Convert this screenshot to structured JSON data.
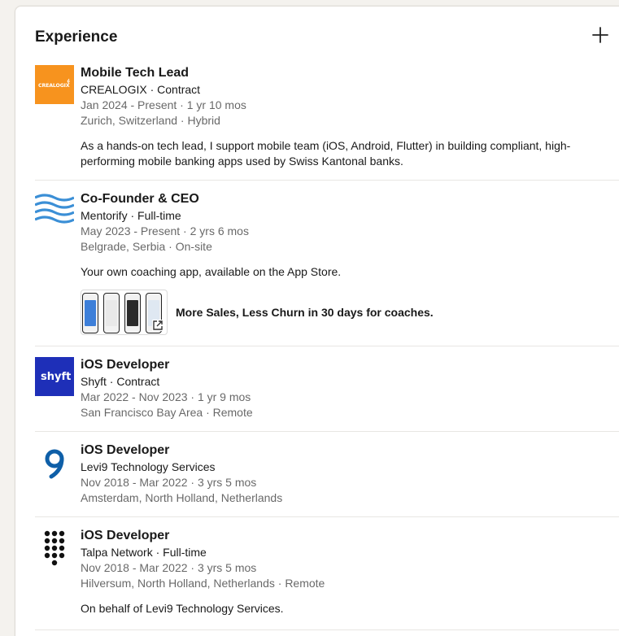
{
  "section": {
    "title": "Experience",
    "add_icon": "plus-icon"
  },
  "colors": {
    "crealogix": "#f7931e",
    "mentorify": "#3b8fd6",
    "shyft": "#1e2fb8",
    "levi9": "#0e5fa8"
  },
  "experience": [
    {
      "logo": "crealogix-logo",
      "logo_text": "CREALOGIX",
      "title": "Mobile Tech Lead",
      "company": "CREALOGIX · Contract",
      "dates": "Jan 2024 - Present · 1 yr 10 mos",
      "location": "Zurich, Switzerland · Hybrid",
      "description": "As a hands-on tech lead, I support mobile team (iOS, Android, Flutter) in building compliant, high-performing mobile banking apps used by Swiss Kantonal banks."
    },
    {
      "logo": "mentorify-logo",
      "title": "Co-Founder & CEO",
      "company": "Mentorify · Full-time",
      "dates": "May 2023 - Present · 2 yrs 6 mos",
      "location": "Belgrade, Serbia · On-site",
      "description": "Your own coaching app, available on the App Store.",
      "media_title": "More Sales, Less Churn in 30 days for coaches."
    },
    {
      "logo": "shyft-logo",
      "logo_text": "shyft",
      "title": "iOS Developer",
      "company": "Shyft · Contract",
      "dates": "Mar 2022 - Nov 2023 · 1 yr 9 mos",
      "location": "San Francisco Bay Area · Remote"
    },
    {
      "logo": "levi9-logo",
      "title": "iOS Developer",
      "company": "Levi9 Technology Services",
      "dates": "Nov 2018 - Mar 2022 · 3 yrs 5 mos",
      "location": "Amsterdam, North Holland, Netherlands"
    },
    {
      "logo": "talpa-logo",
      "title": "iOS Developer",
      "company": "Talpa Network · Full-time",
      "dates": "Nov 2018 - Mar 2022 · 3 yrs 5 mos",
      "location": "Hilversum, North Holland, Netherlands · Remote",
      "description": "On behalf of Levi9 Technology Services."
    }
  ]
}
